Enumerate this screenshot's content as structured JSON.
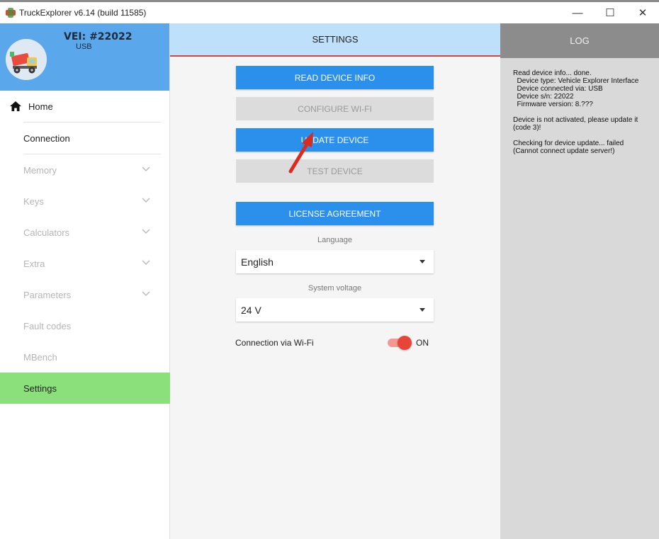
{
  "window": {
    "title": "TruckExplorer v6.14 (build 11585)",
    "minimize": "—",
    "maximize": "☐",
    "close": "✕"
  },
  "device": {
    "name": "VEI: #22022",
    "connection": "USB"
  },
  "sidebar": {
    "items": [
      {
        "label": "Home",
        "icon": "home-icon",
        "enabled": true
      },
      {
        "label": "Connection",
        "enabled": true
      },
      {
        "label": "Memory",
        "enabled": false,
        "expandable": true
      },
      {
        "label": "Keys",
        "enabled": false,
        "expandable": true
      },
      {
        "label": "Calculators",
        "enabled": false,
        "expandable": true
      },
      {
        "label": "Extra",
        "enabled": false,
        "expandable": true
      },
      {
        "label": "Parameters",
        "enabled": false,
        "expandable": true
      },
      {
        "label": "Fault codes",
        "enabled": false
      },
      {
        "label": "MBench",
        "enabled": false
      },
      {
        "label": "Settings",
        "enabled": true,
        "active": true
      }
    ]
  },
  "settings": {
    "title": "SETTINGS",
    "read_info": "READ DEVICE INFO",
    "configure_wifi": "CONFIGURE WI-FI",
    "update_device": "UPDATE DEVICE",
    "test_device": "TEST DEVICE",
    "license": "LICENSE AGREEMENT",
    "language_label": "Language",
    "language_value": "English",
    "voltage_label": "System voltage",
    "voltage_value": "24 V",
    "wifi_label": "Connection via Wi-Fi",
    "wifi_state": "ON"
  },
  "log": {
    "title": "LOG",
    "lines": [
      "Read device info... done.",
      "  Device type: Vehicle Explorer Interface",
      "  Device connected via: USB",
      "  Device s/n: 22022",
      "  Firmware version: 8.???",
      "",
      "Device is not activated, please update it",
      "(code 3)!",
      "",
      "Checking for device update... failed",
      "(Cannot connect update server!)"
    ]
  },
  "colors": {
    "device_header": "#5aa7ec",
    "active_nav": "#8ce07c",
    "primary_button": "#2b8fec",
    "settings_header": "#bfe0fa",
    "log_header": "#8c8c8c",
    "toggle_on": "#e8453a",
    "arrow": "#d92b1f"
  }
}
